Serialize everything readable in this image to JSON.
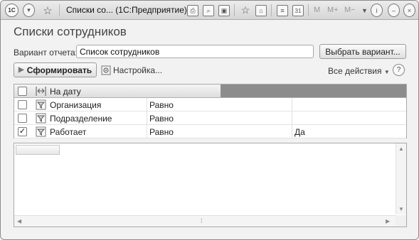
{
  "titlebar": {
    "logo": "1С",
    "title": "Списки со...  (1С:Предприятие)",
    "m": "M",
    "m_plus": "M+",
    "m_minus": "M−",
    "calendar": "31"
  },
  "form": {
    "title": "Списки сотрудников",
    "variant_label": "Вариант отчета:",
    "variant_value": "Список сотрудников",
    "choose_variant_button": "Выбрать вариант...",
    "generate_button": "Сформировать",
    "settings_link": "Настройка...",
    "all_actions": "Все действия",
    "help": "?"
  },
  "settings_table": {
    "header": "На дату",
    "rows": [
      {
        "field": "Организация",
        "condition": "Равно",
        "value": "",
        "checked": false
      },
      {
        "field": "Подразделение",
        "condition": "Равно",
        "value": "",
        "checked": false
      },
      {
        "field": "Работает",
        "condition": "Равно",
        "value": "Да",
        "checked": true
      }
    ]
  },
  "icons": {
    "logo": "1c-logo-icon",
    "back": "circle-chevron-down-icon",
    "favorite": "star-icon",
    "print": "print-icon",
    "preview": "print-preview-icon",
    "save": "save-icon",
    "add_favorite": "star-add-icon",
    "calculator": "calculator-icon",
    "calendar": "calendar-icon",
    "filter": "funnel-icon",
    "gear": "gear-icon"
  }
}
